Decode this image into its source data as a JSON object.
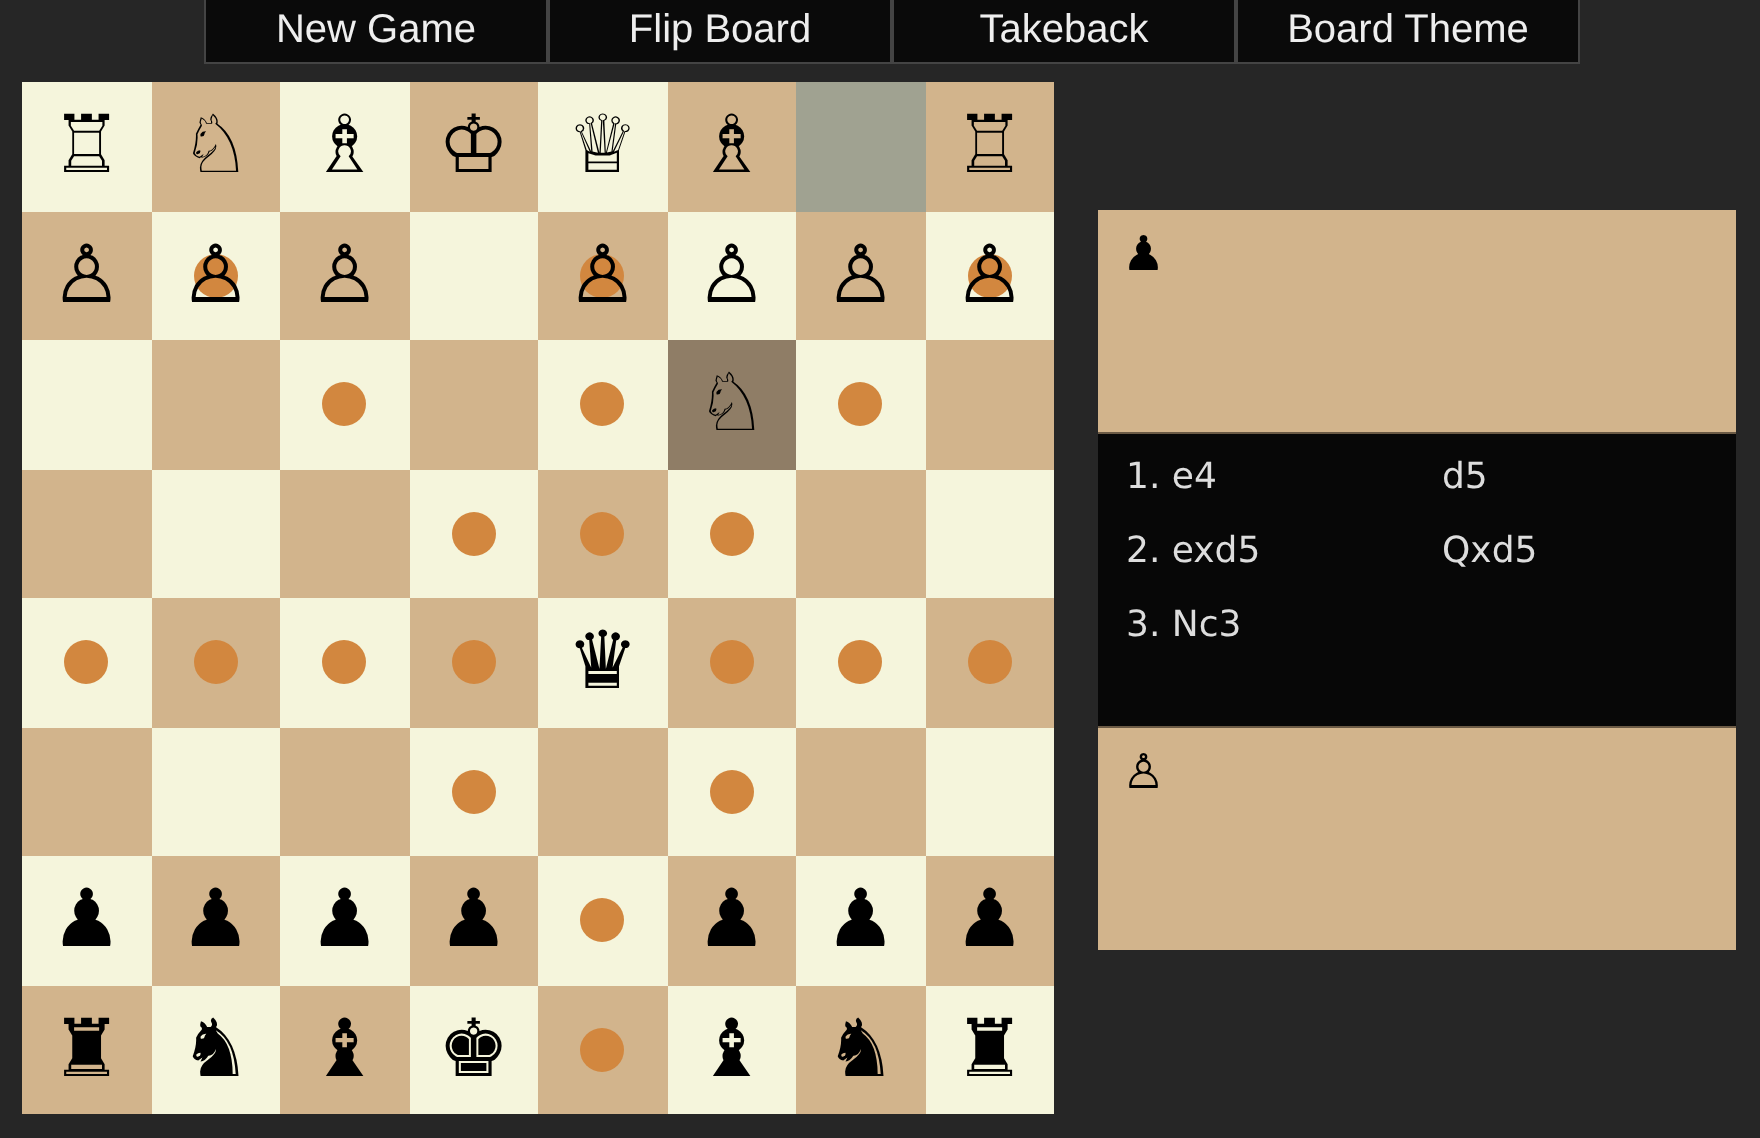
{
  "toolbar": {
    "buttons": [
      "New Game",
      "Flip Board",
      "Takeback",
      "Board Theme"
    ]
  },
  "board": {
    "rows": [
      [
        {
          "piece": "♖",
          "move_target": false
        },
        {
          "piece": "♘",
          "move_target": false
        },
        {
          "piece": "♗",
          "move_target": false
        },
        {
          "piece": "♔",
          "move_target": false
        },
        {
          "piece": "♕",
          "move_target": false
        },
        {
          "piece": "♗",
          "move_target": false
        },
        {
          "move_target": false,
          "color": "#a0a291"
        },
        {
          "piece": "♖",
          "move_target": false
        }
      ],
      [
        {
          "piece": "♙",
          "move_target": false
        },
        {
          "piece": "♙",
          "move_target": true
        },
        {
          "piece": "♙",
          "move_target": false
        },
        {
          "move_target": false
        },
        {
          "piece": "♙",
          "move_target": true
        },
        {
          "piece": "♙",
          "move_target": false
        },
        {
          "piece": "♙",
          "move_target": false
        },
        {
          "piece": "♙",
          "move_target": true
        }
      ],
      [
        {
          "move_target": false
        },
        {
          "move_target": false
        },
        {
          "move_target": true
        },
        {
          "move_target": false
        },
        {
          "move_target": true
        },
        {
          "piece": "♘",
          "move_target": false,
          "color": "#8f7d66"
        },
        {
          "move_target": true
        },
        {
          "move_target": false
        }
      ],
      [
        {
          "move_target": false
        },
        {
          "move_target": false
        },
        {
          "move_target": false
        },
        {
          "move_target": true
        },
        {
          "move_target": true
        },
        {
          "move_target": true
        },
        {
          "move_target": false
        },
        {
          "move_target": false
        }
      ],
      [
        {
          "move_target": true
        },
        {
          "move_target": true
        },
        {
          "move_target": true
        },
        {
          "move_target": true
        },
        {
          "piece": "♛",
          "move_target": false
        },
        {
          "move_target": true
        },
        {
          "move_target": true
        },
        {
          "move_target": true
        }
      ],
      [
        {
          "move_target": false
        },
        {
          "move_target": false
        },
        {
          "move_target": false
        },
        {
          "move_target": true
        },
        {
          "move_target": false
        },
        {
          "move_target": true
        },
        {
          "move_target": false
        },
        {
          "move_target": false
        }
      ],
      [
        {
          "piece": "♟",
          "move_target": false
        },
        {
          "piece": "♟",
          "move_target": false
        },
        {
          "piece": "♟",
          "move_target": false
        },
        {
          "piece": "♟",
          "move_target": false
        },
        {
          "move_target": true
        },
        {
          "piece": "♟",
          "move_target": false
        },
        {
          "piece": "♟",
          "move_target": false
        },
        {
          "piece": "♟",
          "move_target": false
        }
      ],
      [
        {
          "piece": "♜",
          "move_target": false
        },
        {
          "piece": "♞",
          "move_target": false
        },
        {
          "piece": "♝",
          "move_target": false
        },
        {
          "piece": "♚",
          "move_target": false
        },
        {
          "move_target": true
        },
        {
          "piece": "♝",
          "move_target": false
        },
        {
          "piece": "♞",
          "move_target": false
        },
        {
          "piece": "♜",
          "move_target": false
        }
      ]
    ]
  },
  "side_panel": {
    "top_captured": [
      "♟"
    ],
    "moves": [
      {
        "white": "1. e4",
        "black": "d5"
      },
      {
        "white": "2. exd5",
        "black": "Qxd5"
      },
      {
        "white": "3. Nc3"
      }
    ],
    "bottom_captured": [
      "♙"
    ]
  }
}
